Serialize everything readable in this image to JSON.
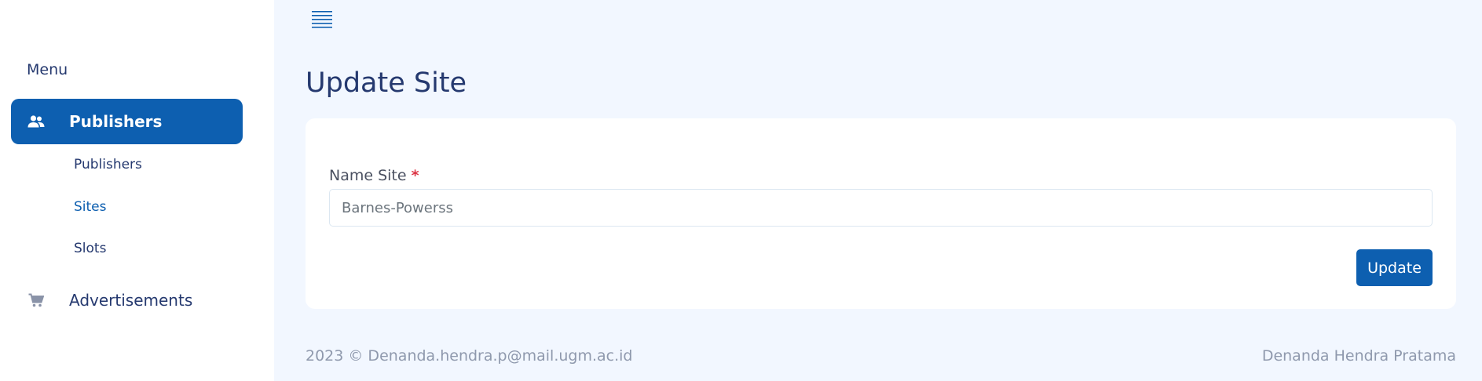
{
  "sidebar": {
    "menu_title": "Menu",
    "items": [
      {
        "label": "Publishers",
        "icon": "people-icon",
        "active": true,
        "children": [
          {
            "label": "Publishers"
          },
          {
            "label": "Sites",
            "current": true
          },
          {
            "label": "Slots"
          }
        ]
      },
      {
        "label": "Advertisements",
        "icon": "cart-icon",
        "active": false
      }
    ]
  },
  "main": {
    "page_title": "Update Site",
    "form": {
      "name_site_label": "Name Site",
      "required_marker": "*",
      "name_site_value": "Barnes-Powerss",
      "submit_label": "Update"
    }
  },
  "footer": {
    "left": "2023 © Denanda.hendra.p@mail.ugm.ac.id",
    "right": "Denanda Hendra Pratama"
  },
  "colors": {
    "primary": "#0d5fb0",
    "background": "#f2f7ff",
    "text": "#25396f",
    "required": "#dc3545",
    "muted": "#8f99ad"
  }
}
